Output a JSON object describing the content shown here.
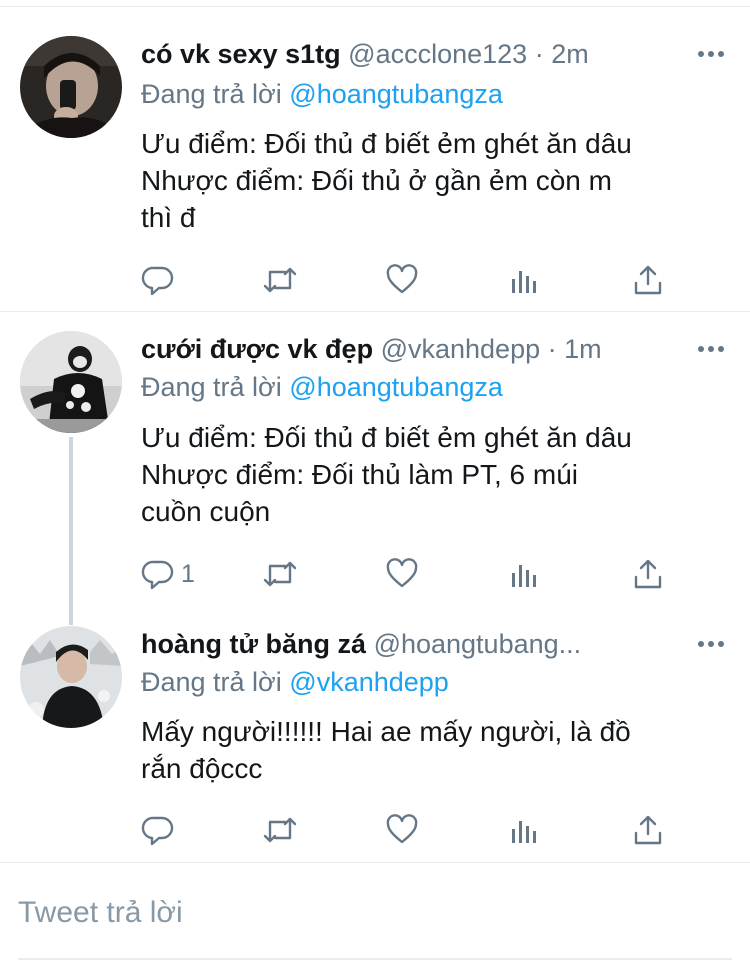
{
  "tweets": [
    {
      "name": "có vk sexy s1tg",
      "handle": "@accclone123",
      "dot": "·",
      "time": "2m",
      "replying_prefix": "Đang trả lời",
      "replying_to": "@hoangtubangza",
      "lines": [
        "Ưu điểm: Đối thủ đ biết ẻm ghét ăn dâu",
        "Nhược điểm: Đối thủ ở gần ẻm còn m",
        "thì đ"
      ],
      "reply_count": ""
    },
    {
      "name": "cưới được vk đẹp",
      "handle": "@vkanhdepp",
      "dot": "·",
      "time": "1m",
      "replying_prefix": "Đang trả lời",
      "replying_to": "@hoangtubangza",
      "lines": [
        "Ưu điểm: Đối thủ đ biết ẻm ghét ăn dâu",
        "Nhược điểm: Đối thủ làm PT, 6 múi",
        "cuồn cuộn"
      ],
      "reply_count": "1"
    },
    {
      "name": "hoàng tử băng zá",
      "handle": "@hoangtubang...",
      "dot": "",
      "time": "",
      "replying_prefix": "Đang trả lời",
      "replying_to": "@vkanhdepp",
      "lines": [
        "Mấy người!!!!!! Hai ae mấy người, là đồ",
        "rắn độccc"
      ],
      "reply_count": ""
    }
  ],
  "compose": {
    "placeholder": "Tweet trả lời"
  },
  "colors": {
    "accent": "#1da1f2",
    "muted": "#657786",
    "text": "#14171a",
    "divider": "#e6ecf0"
  }
}
